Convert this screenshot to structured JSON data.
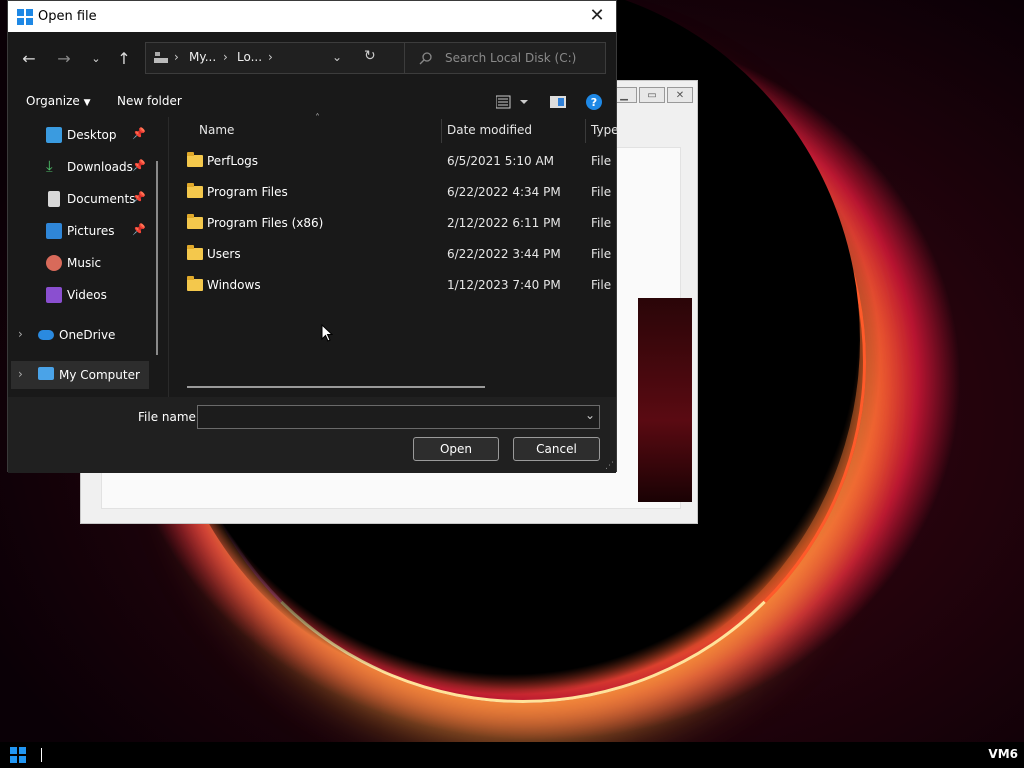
{
  "dialog": {
    "title": "Open file",
    "close_glyph": "✕",
    "address": {
      "segments": [
        "My...",
        "Lo..."
      ],
      "separator": "›"
    },
    "search": {
      "placeholder": "Search Local Disk (C:)"
    },
    "toolbar": {
      "organize": "Organize",
      "new_folder": "New folder"
    },
    "sidebar": {
      "items": [
        {
          "label": "Desktop",
          "icon": "desktop-icon",
          "pinned": true
        },
        {
          "label": "Downloads",
          "icon": "download-icon",
          "pinned": true
        },
        {
          "label": "Documents",
          "icon": "document-icon",
          "pinned": true
        },
        {
          "label": "Pictures",
          "icon": "picture-icon",
          "pinned": true
        },
        {
          "label": "Music",
          "icon": "music-icon",
          "pinned": false
        },
        {
          "label": "Videos",
          "icon": "video-icon",
          "pinned": false
        },
        {
          "label": "OneDrive",
          "icon": "cloud-icon",
          "pinned": false
        },
        {
          "label": "My Computer",
          "icon": "computer-icon",
          "pinned": false
        }
      ]
    },
    "columns": {
      "name": "Name",
      "date": "Date modified",
      "type": "Type"
    },
    "files": [
      {
        "name": "PerfLogs",
        "date": "6/5/2021 5:10 AM",
        "type": "File folder"
      },
      {
        "name": "Program Files",
        "date": "6/22/2022 4:34 PM",
        "type": "File folder"
      },
      {
        "name": "Program Files (x86)",
        "date": "2/12/2022 6:11 PM",
        "type": "File folder"
      },
      {
        "name": "Users",
        "date": "6/22/2022 3:44 PM",
        "type": "File folder"
      },
      {
        "name": "Windows",
        "date": "1/12/2023 7:40 PM",
        "type": "File folder"
      }
    ],
    "footer": {
      "filename_label": "File name:",
      "filename_value": "",
      "open_label": "Open",
      "cancel_label": "Cancel"
    }
  },
  "taskbar": {
    "host": "VM6"
  },
  "colors": {
    "accent": "#1e88e5",
    "folder": "#f4c84c",
    "dialog_bg": "#191919"
  }
}
